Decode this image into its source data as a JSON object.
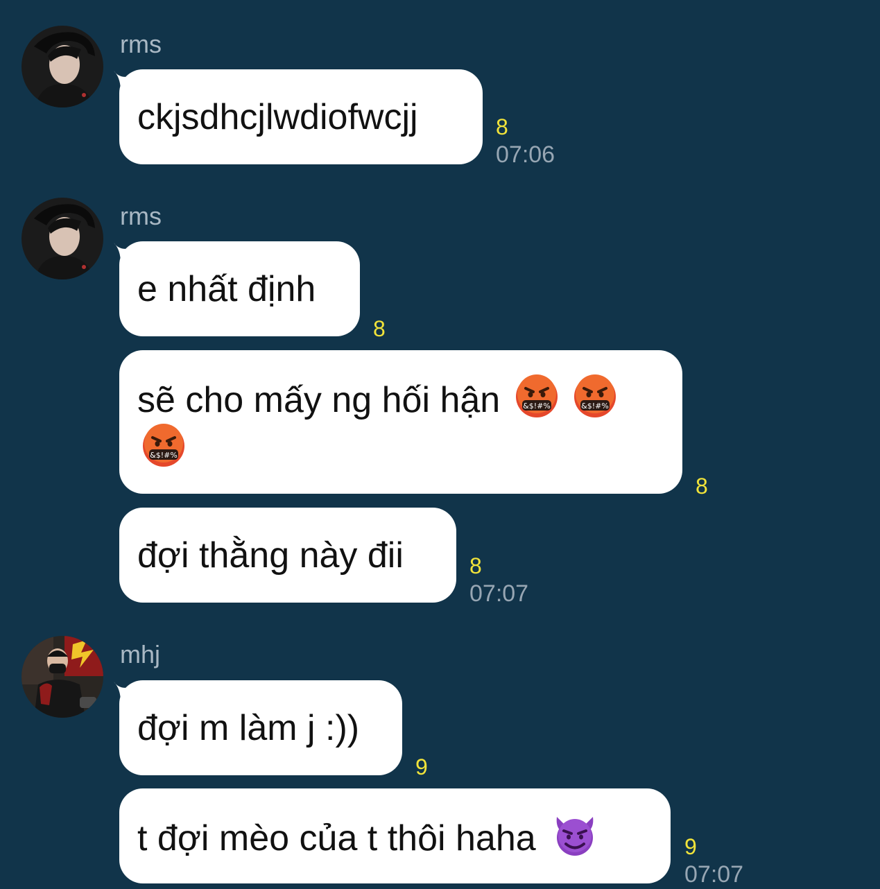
{
  "messages": [
    {
      "sender": "rms",
      "text": "ckjsdhcjlwdiofwcjj",
      "read": "8",
      "time": "07:06"
    },
    {
      "sender": "rms",
      "text": "e nhất định",
      "read": "8"
    },
    {
      "text": "sẽ cho mấy ng hối hận",
      "emojis": [
        "face-with-symbols-on-mouth-icon",
        "face-with-symbols-on-mouth-icon",
        "face-with-symbols-on-mouth-icon"
      ],
      "read": "8"
    },
    {
      "text": "đợi thằng này đii",
      "read": "8",
      "time": "07:07"
    },
    {
      "sender": "mhj",
      "text": "đợi m làm j :))",
      "read": "9"
    },
    {
      "text": "t đợi mèo của t thôi haha",
      "emojis": [
        "smiling-face-with-horns-icon"
      ],
      "read": "9",
      "time": "07:07"
    }
  ],
  "colors": {
    "background": "#11344a",
    "bubble": "#ffffff",
    "read_count": "#f1e33a",
    "timestamp": "#97a6b3",
    "sender_name": "#a9b8c4"
  }
}
